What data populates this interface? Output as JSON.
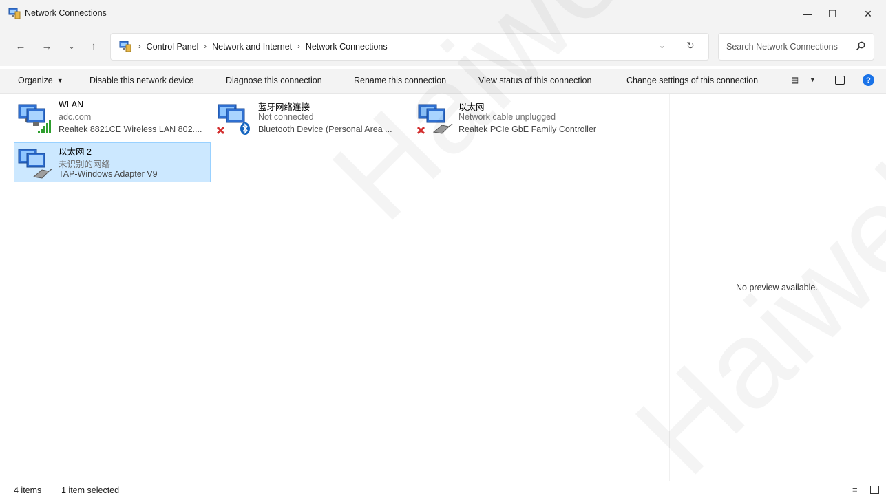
{
  "window": {
    "title": "Network Connections",
    "controls": {
      "minimize": "—",
      "maximize": "☐",
      "close": "✕"
    }
  },
  "nav": {
    "back_icon": "←",
    "forward_icon": "→",
    "recent_icon": "⌄",
    "up_icon": "↑",
    "breadcrumbs": [
      "Control Panel",
      "Network and Internet",
      "Network Connections"
    ],
    "refresh_icon": "↻"
  },
  "search": {
    "placeholder": "Search Network Connections"
  },
  "commands": {
    "organize": "Organize",
    "disable": "Disable this network device",
    "diagnose": "Diagnose this connection",
    "rename": "Rename this connection",
    "view_status": "View status of this connection",
    "change_settings": "Change settings of this connection",
    "help": "?"
  },
  "connections": [
    {
      "name": "WLAN",
      "status": "adc.com",
      "device": "Realtek 8821CE Wireless LAN 802....",
      "icon": "wifi-signal-icon",
      "selected": false
    },
    {
      "name": "蓝牙网络连接",
      "status": "Not connected",
      "device": "Bluetooth Device (Personal Area ...",
      "icon": "bluetooth-icon",
      "selected": false
    },
    {
      "name": "以太网",
      "status": "Network cable unplugged",
      "device": "Realtek PCIe GbE Family Controller",
      "icon": "ethernet-cable-icon",
      "selected": false
    },
    {
      "name": "以太网 2",
      "status": "未识别的网络",
      "device": "TAP-Windows Adapter V9",
      "icon": "ethernet-cable-icon",
      "selected": true
    }
  ],
  "preview": {
    "message": "No preview available."
  },
  "statusbar": {
    "item_count": "4 items",
    "selection": "1 item selected"
  },
  "watermark": {
    "text": "Haiwell"
  },
  "colors": {
    "selection_bg": "#cce8ff",
    "selection_border": "#99d1ff",
    "help_blue": "#1a73e8",
    "error_red": "#d32f2f",
    "signal_green": "#2e9e2e"
  }
}
